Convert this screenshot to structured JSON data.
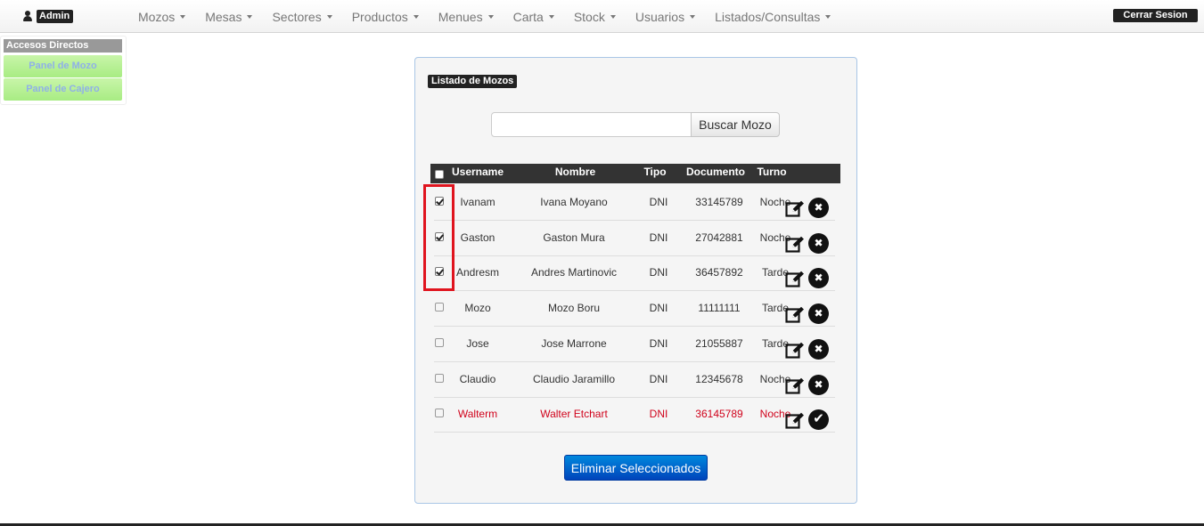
{
  "navbar": {
    "user": "Admin",
    "menu": [
      {
        "label": "Mozos"
      },
      {
        "label": "Mesas"
      },
      {
        "label": "Sectores"
      },
      {
        "label": "Productos"
      },
      {
        "label": "Menues"
      },
      {
        "label": "Carta"
      },
      {
        "label": "Stock"
      },
      {
        "label": "Usuarios"
      },
      {
        "label": "Listados/Consultas"
      }
    ],
    "logout_label": "Cerrar Sesion"
  },
  "shortcuts": {
    "title": "Accesos Directos",
    "items": [
      {
        "label": "Panel de Mozo"
      },
      {
        "label": "Panel de Cajero"
      }
    ]
  },
  "panel": {
    "title": "Listado de Mozos",
    "search": {
      "value": "",
      "placeholder": "",
      "button_label": "Buscar Mozo"
    },
    "columns": [
      "Username",
      "Nombre",
      "Tipo",
      "Documento",
      "Turno"
    ],
    "rows": [
      {
        "username": "Ivanam",
        "nombre": "Ivana Moyano",
        "tipo": "DNI",
        "documento": "33145789",
        "turno": "Noche",
        "checked": true,
        "active": true,
        "action_icon": "delete-icon"
      },
      {
        "username": "Gaston",
        "nombre": "Gaston Mura",
        "tipo": "DNI",
        "documento": "27042881",
        "turno": "Noche",
        "checked": true,
        "active": true,
        "action_icon": "delete-icon"
      },
      {
        "username": "Andresm",
        "nombre": "Andres Martinovic",
        "tipo": "DNI",
        "documento": "36457892",
        "turno": "Tarde",
        "checked": true,
        "active": true,
        "action_icon": "delete-icon"
      },
      {
        "username": "Mozo",
        "nombre": "Mozo Boru",
        "tipo": "DNI",
        "documento": "11111111",
        "turno": "Tarde",
        "checked": false,
        "active": true,
        "action_icon": "delete-icon"
      },
      {
        "username": "Jose",
        "nombre": "Jose Marrone",
        "tipo": "DNI",
        "documento": "21055887",
        "turno": "Tarde",
        "checked": false,
        "active": true,
        "action_icon": "delete-icon"
      },
      {
        "username": "Claudio",
        "nombre": "Claudio Jaramillo",
        "tipo": "DNI",
        "documento": "12345678",
        "turno": "Noche",
        "checked": false,
        "active": true,
        "action_icon": "delete-icon"
      },
      {
        "username": "Walterm",
        "nombre": "Walter Etchart",
        "tipo": "DNI",
        "documento": "36145789",
        "turno": "Noche",
        "checked": false,
        "active": false,
        "action_icon": "activate-icon"
      }
    ],
    "delete_selected_label": "Eliminar Seleccionados"
  },
  "colors": {
    "inactive_row": "#d0021b",
    "highlight_border": "#e0141e",
    "primary_button": "#0055cc",
    "shortcut_button": "#b8f096"
  }
}
